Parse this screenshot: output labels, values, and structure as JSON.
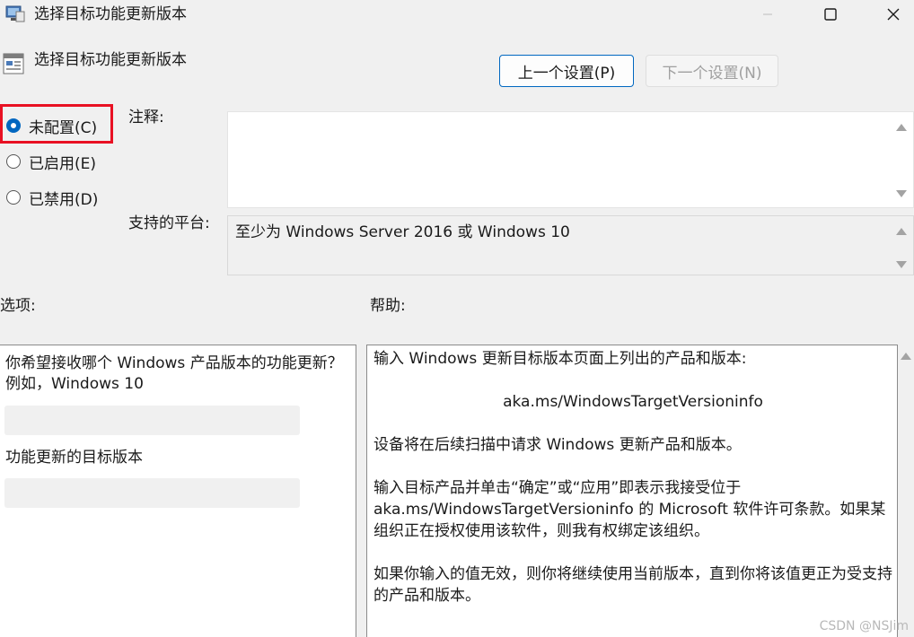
{
  "window": {
    "title": "选择目标功能更新版本",
    "controls": {
      "minimize": "minimize-icon",
      "maximize": "maximize-icon",
      "close": "close-icon"
    }
  },
  "header": {
    "title": "选择目标功能更新版本",
    "prev_button": "上一个设置(P)",
    "next_button": "下一个设置(N)"
  },
  "state": {
    "options": [
      {
        "label": "未配置(C)",
        "checked": true
      },
      {
        "label": "已启用(E)",
        "checked": false
      },
      {
        "label": "已禁用(D)",
        "checked": false
      }
    ]
  },
  "comment": {
    "label": "注释:",
    "value": ""
  },
  "platform": {
    "label": "支持的平台:",
    "value": "至少为 Windows Server 2016 或 Windows 10"
  },
  "options_panel": {
    "label": "选项:",
    "description": "你希望接收哪个 Windows 产品版本的功能更新？例如，Windows 10",
    "product_version_value": "",
    "target_version_label": "功能更新的目标版本",
    "target_version_value": ""
  },
  "help_panel": {
    "label": "帮助:",
    "paragraphs": [
      "输入 Windows 更新目标版本页面上列出的产品和版本:",
      "aka.ms/WindowsTargetVersioninfo",
      "设备将在后续扫描中请求 Windows 更新产品和版本。",
      "输入目标产品并单击“确定”或“应用”即表示我接受位于 aka.ms/WindowsTargetVersioninfo 的 Microsoft 软件许可条款。如果某组织正在授权使用该软件，则我有权绑定该组织。",
      "如果你输入的值无效，则你将继续使用当前版本，直到你将该值更正为受支持的产品和版本。"
    ]
  },
  "watermark": "CSDN @NSJim",
  "colors": {
    "accent": "#0067c0",
    "highlight": "#e81123",
    "background": "#f0f0f0"
  }
}
